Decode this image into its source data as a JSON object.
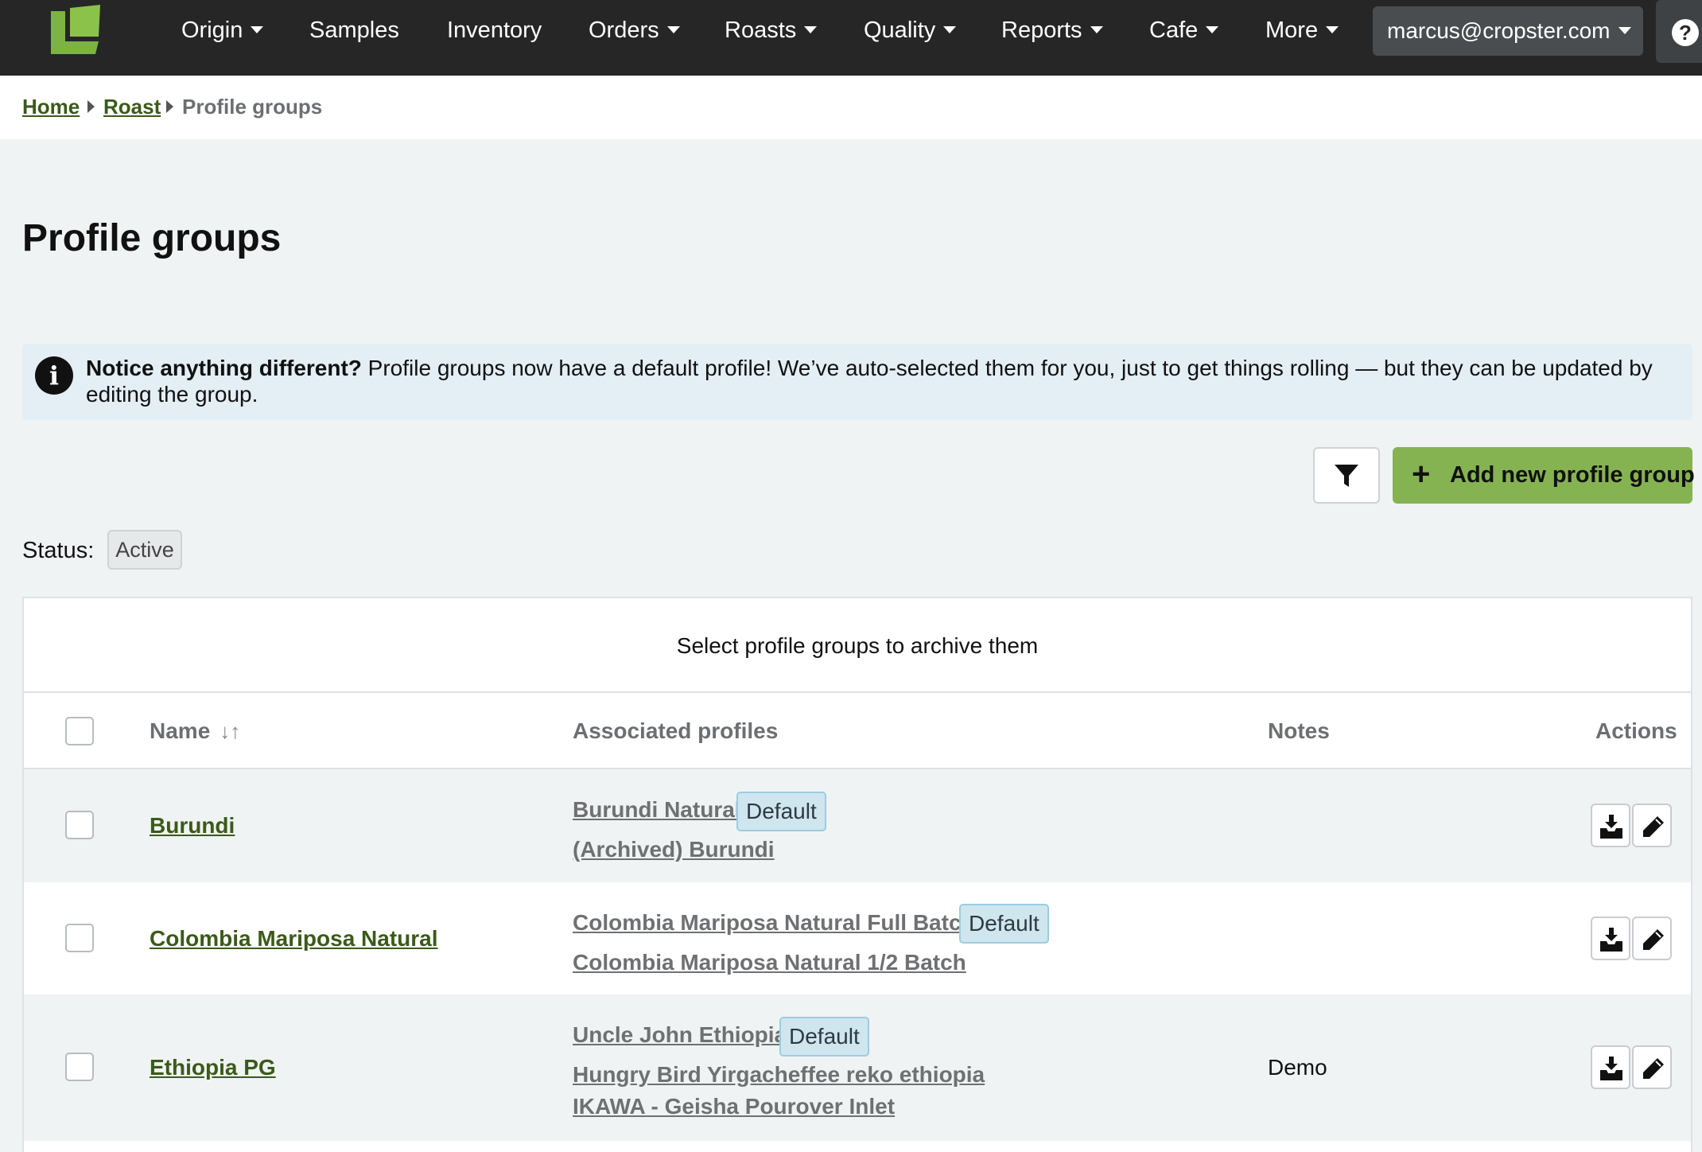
{
  "nav": {
    "items": [
      {
        "label": "Origin",
        "dropdown": true
      },
      {
        "label": "Samples",
        "dropdown": false
      },
      {
        "label": "Inventory",
        "dropdown": false
      },
      {
        "label": "Orders",
        "dropdown": true
      },
      {
        "label": "Roasts",
        "dropdown": true
      },
      {
        "label": "Quality",
        "dropdown": true
      },
      {
        "label": "Reports",
        "dropdown": true
      },
      {
        "label": "Cafe",
        "dropdown": true
      },
      {
        "label": "More",
        "dropdown": true
      }
    ],
    "user": "marcus@cropster.com",
    "help_icon": "?"
  },
  "breadcrumb": {
    "home": "Home",
    "roast": "Roast",
    "current": "Profile groups"
  },
  "page": {
    "title": "Profile groups"
  },
  "notice": {
    "bold": "Notice anything different?",
    "text": " Profile groups now have a default profile! We’ve auto-selected them for you, just to get things rolling — but they can be updated by editing the group."
  },
  "toolbar": {
    "add_label": "Add new profile group",
    "add_icon": "+"
  },
  "filter": {
    "status_label": "Status:",
    "status_value": "Active"
  },
  "table": {
    "archive_hint": "Select profile groups to archive them",
    "headers": {
      "name": "Name",
      "profiles": "Associated profiles",
      "notes": "Notes",
      "actions": "Actions"
    },
    "default_label": "Default",
    "rows": [
      {
        "name": "Burundi",
        "profiles": [
          "Burundi Natural",
          "(Archived) Burundi"
        ],
        "notes": ""
      },
      {
        "name": "Colombia Mariposa Natural",
        "profiles": [
          "Colombia Mariposa Natural Full Batch",
          "Colombia Mariposa Natural 1/2 Batch"
        ],
        "notes": ""
      },
      {
        "name": "Ethiopia PG",
        "profiles": [
          "Uncle John Ethiopia",
          "Hungry Bird Yirgacheffee reko ethiopia",
          "IKAWA - Geisha Pourover Inlet"
        ],
        "notes": "Demo"
      }
    ]
  },
  "colors": {
    "nav_bg": "#262626",
    "accent_green": "#86b352",
    "link_green": "#3b5a1a",
    "badge_bg": "#cfe6ef",
    "notice_bg": "#e3eef5"
  }
}
